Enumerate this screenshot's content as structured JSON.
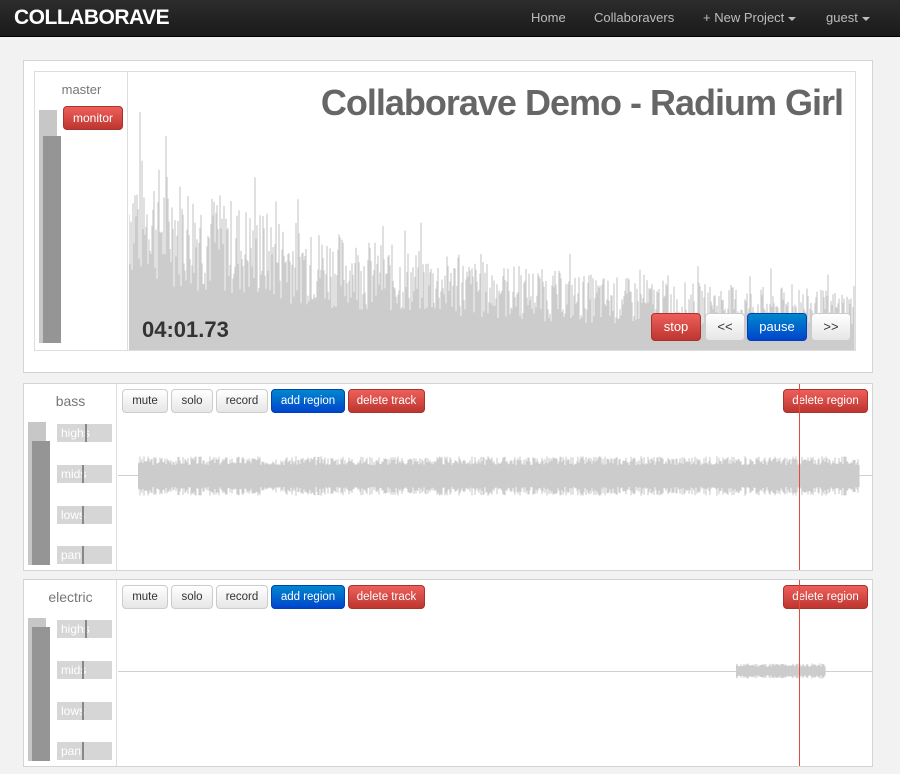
{
  "navbar": {
    "brand": "COLLABORAVE",
    "items": [
      "Home",
      "Collaboravers",
      "+ New Project",
      "guest"
    ]
  },
  "master": {
    "label": "master",
    "monitor_label": "monitor",
    "title": "Collaborave Demo - Radium Girl",
    "timecode": "04:01.73",
    "meter_level": 0.89,
    "transport": {
      "stop": "stop",
      "rewind": "<<",
      "pause": "pause",
      "forward": ">>"
    }
  },
  "tracks": [
    {
      "label": "bass",
      "meter_level": 0.87,
      "knobs": [
        "highs",
        "mids",
        "lows",
        "pan"
      ],
      "buttons": {
        "mute": "mute",
        "solo": "solo",
        "record": "record",
        "add_region": "add region",
        "delete_track": "delete track",
        "delete_region": "delete region"
      }
    },
    {
      "label": "electric",
      "meter_level": 0.94,
      "knobs": [
        "highs",
        "mids",
        "lows",
        "pan"
      ],
      "buttons": {
        "mute": "mute",
        "solo": "solo",
        "record": "record",
        "add_region": "add region",
        "delete_track": "delete track",
        "delete_region": "delete region"
      }
    }
  ],
  "colors": {
    "danger": "#bd362f",
    "primary": "#0044cc",
    "waveform": "#cccccc",
    "playhead": "#e34a42"
  }
}
